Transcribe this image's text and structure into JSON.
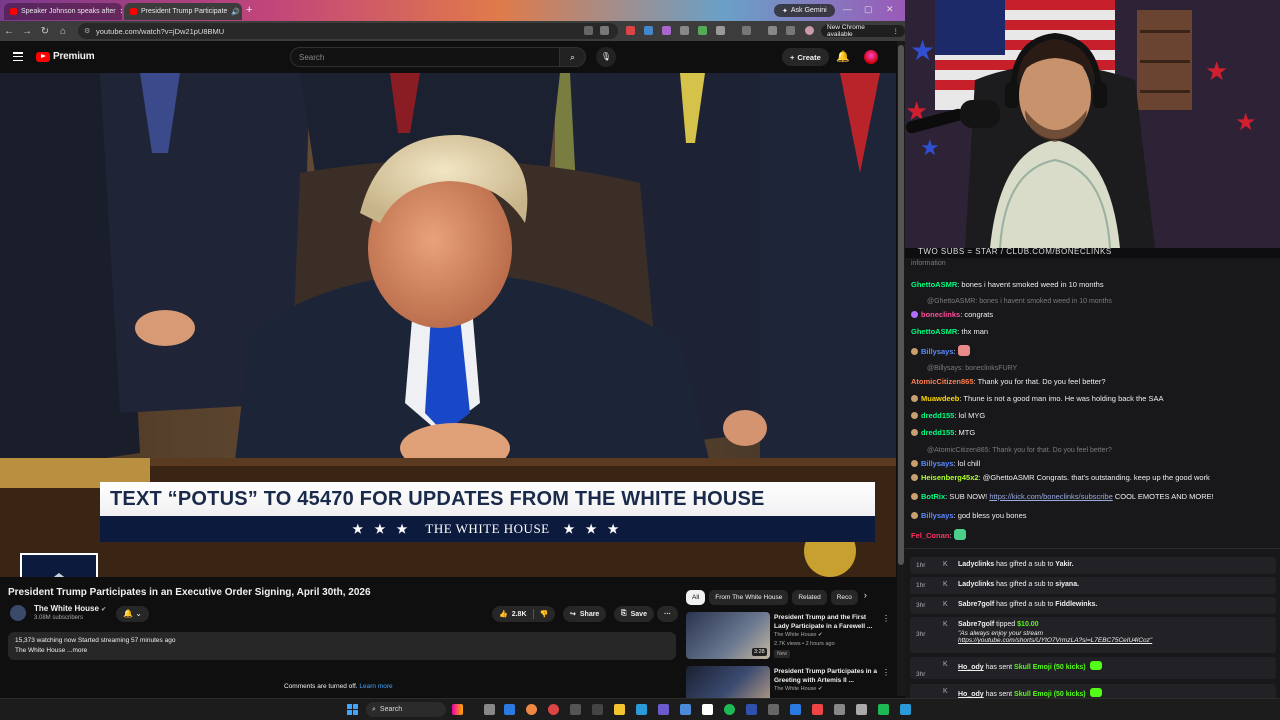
{
  "browser": {
    "tabs": [
      {
        "label": "Speaker Johnson speaks after",
        "close": "✕"
      },
      {
        "label": "President Trump Participate",
        "close": "✕"
      }
    ],
    "new_tab": "+",
    "ask_gemini": "Ask Gemini",
    "url": "youtube.com/watch?v=jDw21pU8BMU",
    "new_chrome": "New Chrome available",
    "window_controls": [
      "—",
      "▢",
      "✕"
    ]
  },
  "youtube": {
    "logo_text": "Premium",
    "search_placeholder": "Search",
    "create_label": "Create",
    "video": {
      "lower_third_headline": "TEXT “POTUS” TO 45470 FOR UPDATES FROM THE WHITE HOUSE",
      "lower_third_brand": "THE WHITE HOUSE",
      "stars": "★ ★ ★"
    },
    "title": "President Trump Participates in an Executive Order Signing, April 30th, 2026",
    "channel": {
      "name": "The White House",
      "subscribers": "3.08M subscribers"
    },
    "actions": {
      "likes": "2.8K",
      "share": "Share",
      "save": "Save",
      "more": "···"
    },
    "description": {
      "line1": "15,373 watching now  Started streaming 57 minutes ago",
      "line2": "The White House ...more"
    },
    "comments_off": "Comments are turned off.",
    "learn_more": "Learn more",
    "rec_chips": [
      "All",
      "From The White House",
      "Related",
      "Reco"
    ],
    "recommendations": [
      {
        "title": "President Trump and the First Lady Participate in a Farewell ...",
        "channel": "The White House",
        "meta": "2.7K views • 2 hours ago",
        "badge": "New",
        "duration": "3:28"
      },
      {
        "title": "President Trump Participates in a Greeting with Artemis II ...",
        "channel": "The White House",
        "meta": "",
        "badge": "",
        "duration": ""
      }
    ]
  },
  "stream": {
    "banner": "TWO SUBS = STAR / CLUB.COM/BONECLINKS",
    "chat": [
      {
        "kind": "sys",
        "text": "information"
      },
      {
        "kind": "msg",
        "user": "GhettoASMR",
        "color": "#00ff7f",
        "text": "bones i havent smoked weed in 10 months"
      },
      {
        "kind": "reply",
        "text": "@GhettoASMR: bones i havent smoked weed in 10 months"
      },
      {
        "kind": "msg",
        "user": "boneclinks",
        "color": "#ff4f9a",
        "text": "congrats",
        "badged": true
      },
      {
        "kind": "msg",
        "user": "GhettoASMR",
        "color": "#00ff7f",
        "text": "thx man"
      },
      {
        "kind": "msg",
        "user": "Billysays",
        "color": "#5c8aff",
        "text": "",
        "emote": true
      },
      {
        "kind": "reply",
        "text": "@Billysays: boneclinksFURY"
      },
      {
        "kind": "msg",
        "user": "AtomicCitizen865",
        "color": "#ff7f50",
        "text": "Thank you for that. Do you feel better?"
      },
      {
        "kind": "msg",
        "user": "Muawdeeb",
        "color": "#ffd700",
        "text": "Thune is not a good man imo. He was holding back the SAA"
      },
      {
        "kind": "msg",
        "user": "dredd155",
        "color": "#00ff7f",
        "text": "lol MYG"
      },
      {
        "kind": "msg",
        "user": "dredd155",
        "color": "#00ff7f",
        "text": "MTG"
      },
      {
        "kind": "reply",
        "text": "@AtomicCitizen865: Thank you for that. Do you feel better?"
      },
      {
        "kind": "msg",
        "user": "Billysays",
        "color": "#5c8aff",
        "text": "lol chill"
      },
      {
        "kind": "msg",
        "user": "Heisenberg45x2",
        "color": "#adff2f",
        "text": "@GhettoASMR Congrats. that's outstanding. keep up the good work"
      },
      {
        "kind": "msg",
        "user": "BotRix",
        "color": "#00ff7f",
        "text": "SUB NOW! ",
        "link": "https://kick.com/boneclinks/subscribe",
        "after": " COOL EMOTES AND MORE!"
      },
      {
        "kind": "msg",
        "user": "Billysays",
        "color": "#5c8aff",
        "text": "god bless you bones"
      },
      {
        "kind": "msg",
        "user": "Fel_Conan",
        "color": "#ff3060",
        "text": "",
        "emote": true
      }
    ],
    "events": [
      {
        "time": "1hr",
        "user": "Ladyclinks",
        "text": "has gifted a sub to",
        "target": "Yakir."
      },
      {
        "time": "1hr",
        "user": "Ladyclinks",
        "text": "has gifted a sub to",
        "target": "siyana."
      },
      {
        "time": "3hr",
        "user": "Sabre7golf",
        "text": "has gifted a sub to",
        "target": "Fiddlewinks."
      },
      {
        "time": "3hr",
        "user": "Sabre7golf",
        "text": "tipped",
        "amount": "$10.00",
        "quote": "\"As always enjoy your stream",
        "link": "https://youtube.com/shorts/UYtO7VrmzLA?si=L7EBC75CeIU4lCoz\""
      },
      {
        "time": "3hr",
        "user": "Ho_ody",
        "text": "has sent",
        "target": "Skull Emoji (50 kicks)"
      },
      {
        "time": "3hr",
        "user": "Ho_ody",
        "text": "has sent",
        "target": "Skull Emoji (50 kicks)"
      },
      {
        "time": "",
        "user": "Ho_ody",
        "text": "has sent",
        "target": "Skull Emoji (50 kicks)"
      }
    ]
  },
  "taskbar": {
    "search_label": "Search"
  }
}
